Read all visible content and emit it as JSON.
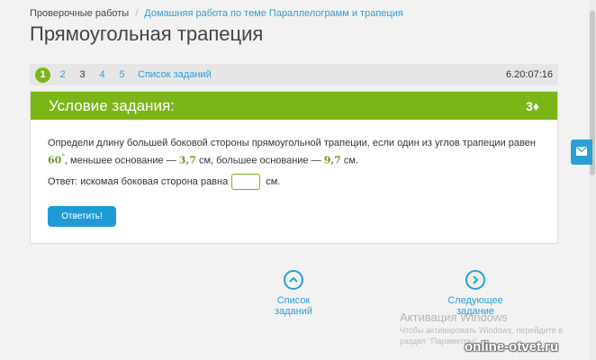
{
  "breadcrumb": {
    "root": "Проверочные работы",
    "separator": "/",
    "current": "Домашняя работа по теме Параллелограмм и трапеция"
  },
  "page": {
    "title": "Прямоугольная трапеция"
  },
  "task_nav": {
    "items": [
      "1",
      "2",
      "3",
      "4",
      "5"
    ],
    "current": "1",
    "list_link": "Список заданий",
    "timer": "6.20:07:16"
  },
  "task": {
    "header_title": "Условие задания:",
    "points": "3♦",
    "text_part1": "Определи длину большей боковой стороны прямоугольной трапеции, если один из углов трапеции равен",
    "angle": "60",
    "degree": "°",
    "text_part2": ", меньшее основание —",
    "small_base": "3,7",
    "text_part3": "см, большее основание —",
    "large_base": "9,7",
    "text_part4": "см.",
    "answer_label": "Ответ: искомая боковая сторона равна",
    "answer_value": "",
    "answer_unit": "см.",
    "submit_label": "Ответить!"
  },
  "bottom_nav": {
    "list_label": "Список заданий",
    "next_label": "Следующее задание"
  },
  "watermark": {
    "title": "Активация Windows",
    "line1": "Чтобы активировать Windows, перейдите в",
    "line2": "раздел \"Параметры\"."
  },
  "brand": "online-otvet.ru",
  "icons": {
    "feedback": "envelope-icon",
    "list": "chevron-up-icon",
    "next": "chevron-right-icon"
  },
  "colors": {
    "accent_green": "#7cb518",
    "link_blue": "#2a9fd6",
    "button_blue": "#1e9bd7"
  }
}
